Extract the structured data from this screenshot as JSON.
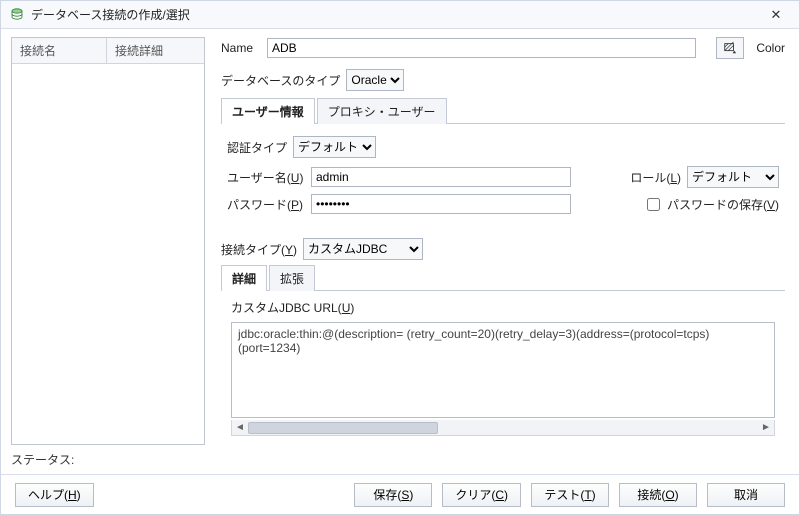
{
  "title": "データベース接続の作成/選択",
  "left": {
    "col_name": "接続名",
    "col_detail": "接続詳細"
  },
  "status_label": "ステータス:",
  "form": {
    "name_label": "Name",
    "name_value": "ADB",
    "color_label": "Color",
    "dbtype_label": "データベースのタイプ",
    "dbtype_value": "Oracle",
    "tabs": {
      "user": "ユーザー情報",
      "proxy": "プロキシ・ユーザー"
    },
    "auth_label": "認証タイプ",
    "auth_value": "デフォルト",
    "username_label": "ユーザー名(U)",
    "username_value": "admin",
    "role_label": "ロール(L)",
    "role_value": "デフォルト",
    "password_label": "パスワード(P)",
    "password_value": "password",
    "save_pw_label": "パスワードの保存(V)",
    "conn_type_label": "接続タイプ(Y)",
    "conn_type_value": "カスタムJDBC",
    "sub_tabs": {
      "detail": "詳細",
      "ext": "拡張"
    },
    "jdbc_url_label": "カスタムJDBC URL(U)",
    "jdbc_url_value": "jdbc:oracle:thin:@(description= (retry_count=20)(retry_delay=3)(address=(protocol=tcps)(port=1234)"
  },
  "buttons": {
    "help": "ヘルプ(H)",
    "save": "保存(S)",
    "clear": "クリア(C)",
    "test": "テスト(T)",
    "connect": "接続(O)",
    "cancel": "取消"
  }
}
